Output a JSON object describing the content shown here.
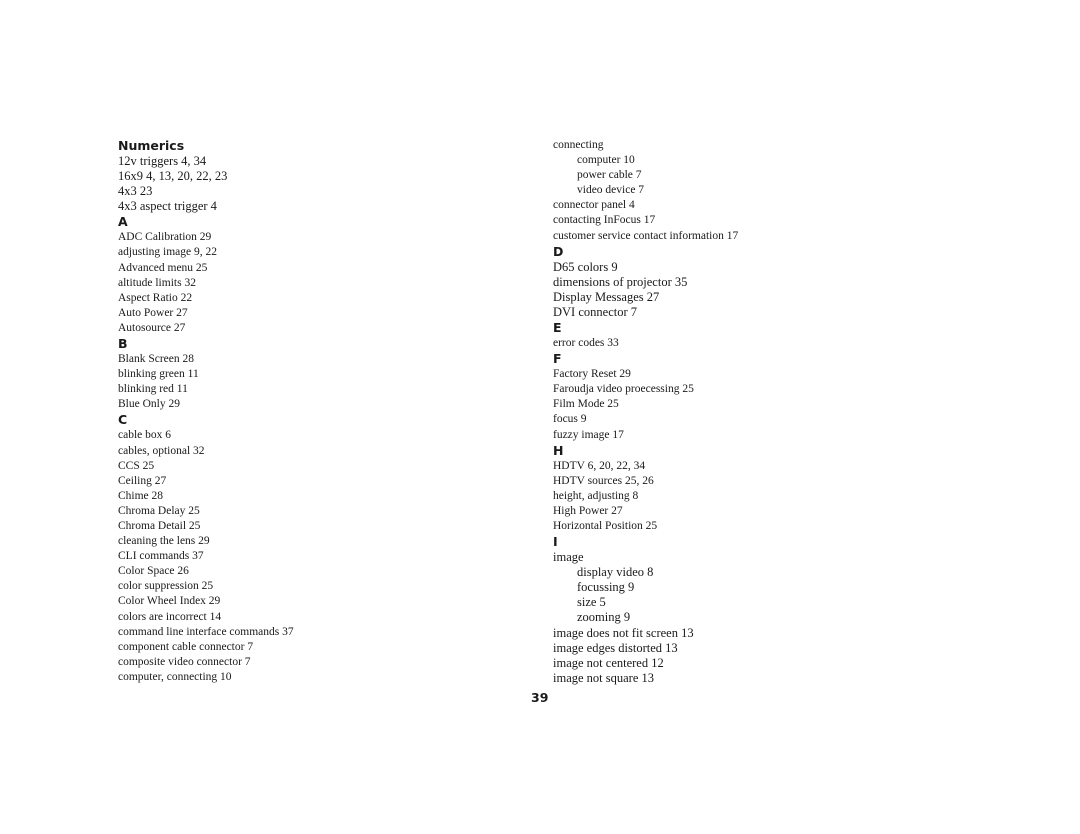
{
  "page_number": "39",
  "left_column": [
    {
      "type": "header",
      "text": "Numerics"
    },
    {
      "type": "entry",
      "size": "lg",
      "text": "12v triggers 4, 34"
    },
    {
      "type": "entry",
      "size": "lg",
      "text": "16x9 4, 13, 20, 22, 23"
    },
    {
      "type": "entry",
      "size": "lg",
      "text": "4x3 23"
    },
    {
      "type": "entry",
      "size": "lg",
      "text": "4x3 aspect trigger 4"
    },
    {
      "type": "letter",
      "text": "A"
    },
    {
      "type": "entry",
      "size": "sm",
      "text": "ADC Calibration 29"
    },
    {
      "type": "entry",
      "size": "sm",
      "text": "adjusting image 9, 22"
    },
    {
      "type": "entry",
      "size": "sm",
      "text": "Advanced menu 25"
    },
    {
      "type": "entry",
      "size": "sm",
      "text": "altitude limits 32"
    },
    {
      "type": "entry",
      "size": "sm",
      "text": "Aspect Ratio 22"
    },
    {
      "type": "entry",
      "size": "sm",
      "text": "Auto Power 27"
    },
    {
      "type": "entry",
      "size": "sm",
      "text": "Autosource 27"
    },
    {
      "type": "letter",
      "text": "B"
    },
    {
      "type": "entry",
      "size": "sm",
      "text": "Blank Screen 28"
    },
    {
      "type": "entry",
      "size": "sm",
      "text": "blinking green 11"
    },
    {
      "type": "entry",
      "size": "sm",
      "text": "blinking red 11"
    },
    {
      "type": "entry",
      "size": "sm",
      "text": "Blue Only 29"
    },
    {
      "type": "letter",
      "text": "C"
    },
    {
      "type": "entry",
      "size": "sm",
      "text": "cable box 6"
    },
    {
      "type": "entry",
      "size": "sm",
      "text": "cables, optional 32"
    },
    {
      "type": "entry",
      "size": "sm",
      "text": "CCS 25"
    },
    {
      "type": "entry",
      "size": "sm",
      "text": "Ceiling 27"
    },
    {
      "type": "entry",
      "size": "sm",
      "text": "Chime 28"
    },
    {
      "type": "entry",
      "size": "sm",
      "text": "Chroma Delay 25"
    },
    {
      "type": "entry",
      "size": "sm",
      "text": "Chroma Detail 25"
    },
    {
      "type": "entry",
      "size": "sm",
      "text": "cleaning the lens 29"
    },
    {
      "type": "entry",
      "size": "sm",
      "text": "CLI commands 37"
    },
    {
      "type": "entry",
      "size": "sm",
      "text": "Color Space 26"
    },
    {
      "type": "entry",
      "size": "sm",
      "text": "color suppression 25"
    },
    {
      "type": "entry",
      "size": "sm",
      "text": "Color Wheel Index 29"
    },
    {
      "type": "entry",
      "size": "sm",
      "text": "colors are incorrect 14"
    },
    {
      "type": "entry",
      "size": "sm",
      "text": "command line interface commands 37"
    },
    {
      "type": "entry",
      "size": "sm",
      "text": "component cable connector 7"
    },
    {
      "type": "entry",
      "size": "sm",
      "text": "composite video connector 7"
    },
    {
      "type": "entry",
      "size": "sm",
      "text": "computer, connecting 10"
    }
  ],
  "right_column": [
    {
      "type": "entry",
      "size": "sm",
      "text": "connecting"
    },
    {
      "type": "subentry",
      "size": "sm",
      "text": "computer 10"
    },
    {
      "type": "subentry",
      "size": "sm",
      "text": "power cable 7"
    },
    {
      "type": "subentry",
      "size": "sm",
      "text": "video device 7"
    },
    {
      "type": "entry",
      "size": "sm",
      "text": "connector panel 4"
    },
    {
      "type": "entry",
      "size": "sm",
      "text": "contacting InFocus 17"
    },
    {
      "type": "entry",
      "size": "sm",
      "text": "customer service contact information 17"
    },
    {
      "type": "letter",
      "text": "D"
    },
    {
      "type": "entry",
      "size": "lg",
      "text": "D65 colors 9"
    },
    {
      "type": "entry",
      "size": "lg",
      "text": "dimensions of projector 35"
    },
    {
      "type": "entry",
      "size": "lg",
      "text": "Display Messages 27"
    },
    {
      "type": "entry",
      "size": "lg",
      "text": "DVI connector 7"
    },
    {
      "type": "letter",
      "text": "E"
    },
    {
      "type": "entry",
      "size": "sm",
      "text": "error codes 33"
    },
    {
      "type": "letter",
      "text": "F"
    },
    {
      "type": "entry",
      "size": "sm",
      "text": "Factory Reset 29"
    },
    {
      "type": "entry",
      "size": "sm",
      "text": "Faroudja video proecessing 25"
    },
    {
      "type": "entry",
      "size": "sm",
      "text": "Film Mode 25"
    },
    {
      "type": "entry",
      "size": "sm",
      "text": "focus 9"
    },
    {
      "type": "entry",
      "size": "sm",
      "text": "fuzzy image 17"
    },
    {
      "type": "letter",
      "text": "H"
    },
    {
      "type": "entry",
      "size": "sm",
      "text": "HDTV 6, 20, 22, 34"
    },
    {
      "type": "entry",
      "size": "sm",
      "text": "HDTV sources 25, 26"
    },
    {
      "type": "entry",
      "size": "sm",
      "text": "height, adjusting 8"
    },
    {
      "type": "entry",
      "size": "sm",
      "text": "High Power 27"
    },
    {
      "type": "entry",
      "size": "sm",
      "text": "Horizontal Position 25"
    },
    {
      "type": "letter",
      "text": "I"
    },
    {
      "type": "entry",
      "size": "lg",
      "text": "image"
    },
    {
      "type": "subentry",
      "size": "lg",
      "text": "display video 8"
    },
    {
      "type": "subentry",
      "size": "lg",
      "text": "focussing 9"
    },
    {
      "type": "subentry",
      "size": "lg",
      "text": "size 5"
    },
    {
      "type": "subentry",
      "size": "lg",
      "text": "zooming 9"
    },
    {
      "type": "entry",
      "size": "lg",
      "text": "image does not fit screen 13"
    },
    {
      "type": "entry",
      "size": "lg",
      "text": "image edges distorted 13"
    },
    {
      "type": "entry",
      "size": "lg",
      "text": "image not centered 12"
    },
    {
      "type": "entry",
      "size": "lg",
      "text": "image not square 13"
    }
  ]
}
